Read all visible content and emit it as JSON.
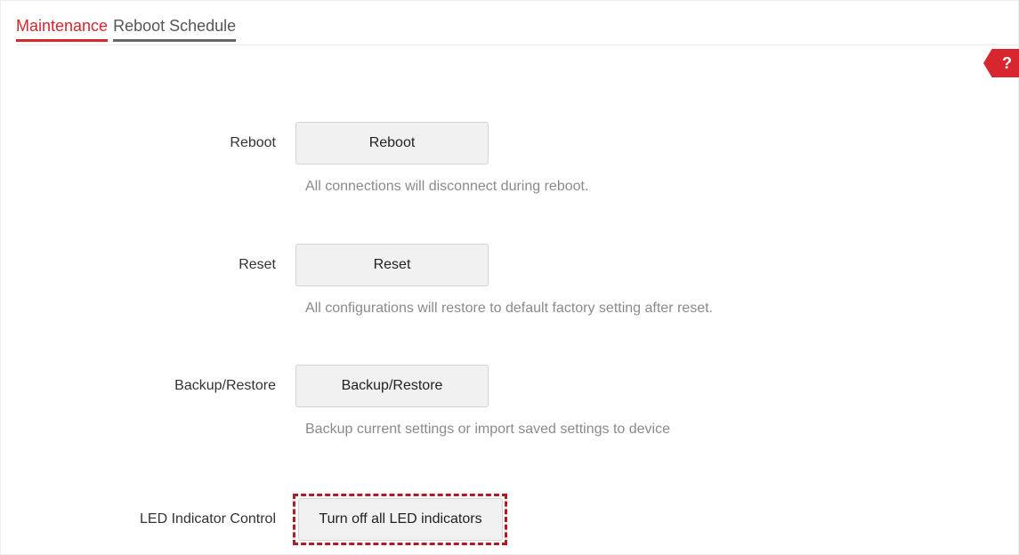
{
  "tabs": {
    "maintenance": "Maintenance",
    "reboot_schedule": "Reboot Schedule"
  },
  "help": {
    "label": "?"
  },
  "sections": {
    "reboot": {
      "label": "Reboot",
      "button": "Reboot",
      "hint": "All connections will disconnect during reboot."
    },
    "reset": {
      "label": "Reset",
      "button": "Reset",
      "hint": "All configurations will restore to default factory setting after reset."
    },
    "backup": {
      "label": "Backup/Restore",
      "button": "Backup/Restore",
      "hint": "Backup current settings or import saved settings to device"
    },
    "led": {
      "label": "LED Indicator Control",
      "button": "Turn off all LED indicators"
    }
  },
  "colors": {
    "accent": "#d7262e",
    "highlight_border": "#b01c22"
  }
}
